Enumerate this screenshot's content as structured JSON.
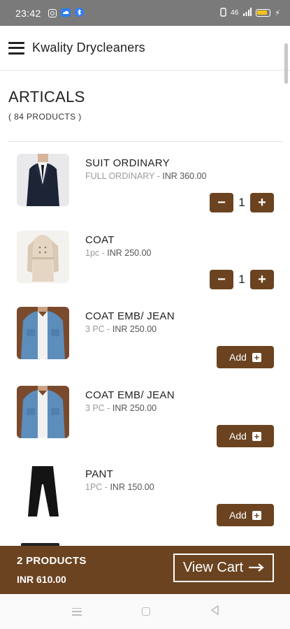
{
  "status_bar": {
    "time": "23:42",
    "left_icons": [
      "instagram-icon",
      "cloud-icon",
      "bluetooth-icon"
    ],
    "right_text": "46",
    "right_icons": [
      "vibrate-icon",
      "signal-icon",
      "battery-icon",
      "charging-icon"
    ]
  },
  "app_bar": {
    "title": "Kwality Drycleaners",
    "menu_icon": "menu-icon"
  },
  "page": {
    "title": "ARTICALS",
    "count": "( 84 PRODUCTS )"
  },
  "products": [
    {
      "name": "SUIT ORDINARY",
      "variant": "FULL ORDINARY",
      "price": "INR 360.00",
      "control": "qty",
      "quantity": "1"
    },
    {
      "name": "COAT",
      "variant": "1pc",
      "price": "INR 250.00",
      "control": "qty",
      "quantity": "1"
    },
    {
      "name": "COAT EMB/ JEAN",
      "variant": "3 PC",
      "price": "INR 250.00",
      "control": "add",
      "add_label": "Add"
    },
    {
      "name": "COAT EMB/ JEAN",
      "variant": "3 PC",
      "price": "INR 250.00",
      "control": "add",
      "add_label": "Add"
    },
    {
      "name": "PANT",
      "variant": "1PC",
      "price": "INR 150.00",
      "control": "add",
      "add_label": "Add"
    }
  ],
  "cart": {
    "count_label": "2 PRODUCTS",
    "total": "INR 610.00",
    "view_cart_label": "View Cart"
  },
  "colors": {
    "brand_brown": "#6b4320",
    "status_bar": "#7a7a7a"
  }
}
